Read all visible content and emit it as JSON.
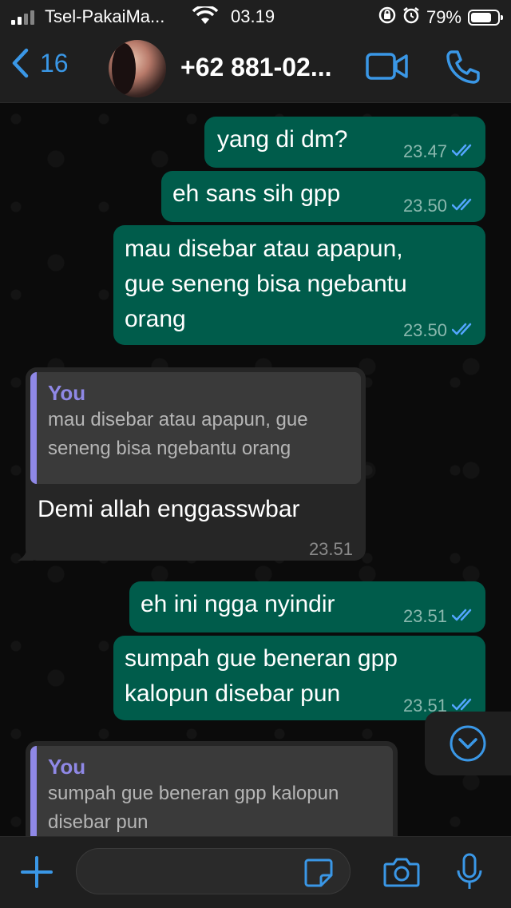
{
  "status_bar": {
    "carrier": "Tsel-PakaiMa...",
    "time": "03.19",
    "battery_percent": "79%",
    "battery_level": 0.79
  },
  "header": {
    "back_count": "16",
    "contact_name": "+62 881-02...",
    "accent_color": "#3a97e6"
  },
  "messages": [
    {
      "dir": "out",
      "text": "yang di dm?",
      "time": "23.47",
      "read": true
    },
    {
      "dir": "out",
      "text": "eh sans sih gpp",
      "time": "23.50",
      "read": true
    },
    {
      "dir": "out",
      "lines": [
        "mau disebar atau apapun,",
        "gue seneng bisa ngebantu",
        "orang"
      ],
      "time": "23.50",
      "read": true
    },
    {
      "dir": "in",
      "quote": {
        "author": "You",
        "lines": [
          "mau disebar atau apapun, gue",
          "seneng bisa ngebantu orang"
        ]
      },
      "text": "Demi allah enggasswbar",
      "time": "23.51"
    },
    {
      "dir": "out",
      "text": "eh ini ngga nyindir",
      "time": "23.51",
      "read": true
    },
    {
      "dir": "out",
      "lines": [
        "sumpah gue beneran gpp",
        "kalopun disebar pun"
      ],
      "time": "23.51",
      "read": true
    },
    {
      "dir": "in",
      "quote": {
        "author": "You",
        "lines": [
          "sumpah gue beneran gpp kalopun",
          "disebar pun"
        ]
      }
    }
  ],
  "composer": {
    "placeholder": ""
  },
  "colors": {
    "outgoing_bubble": "#005c4b",
    "incoming_bubble": "#262626",
    "quote_accent": "#8f88e6",
    "read_tick": "#53a6ff"
  }
}
